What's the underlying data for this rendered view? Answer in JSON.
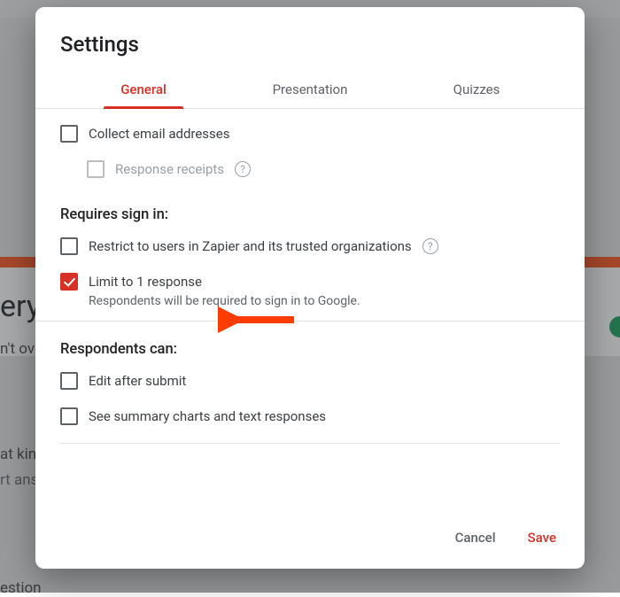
{
  "bg": {
    "word1": "ery",
    "word2": "n't ove",
    "word3": "at kin",
    "word4": "rt ans",
    "word5": "estion"
  },
  "modal": {
    "title": "Settings",
    "tabs": {
      "general": "General",
      "presentation": "Presentation",
      "quizzes": "Quizzes"
    },
    "collect_emails": "Collect email addresses",
    "response_receipts": "Response receipts",
    "section_signin": "Requires sign in:",
    "restrict": "Restrict to users in Zapier and its trusted organizations",
    "limit": "Limit to 1 response",
    "limit_help": "Respondents will be required to sign in to Google.",
    "section_respondents": "Respondents can:",
    "edit_after": "Edit after submit",
    "see_summary": "See summary charts and text responses",
    "buttons": {
      "cancel": "Cancel",
      "save": "Save"
    }
  }
}
